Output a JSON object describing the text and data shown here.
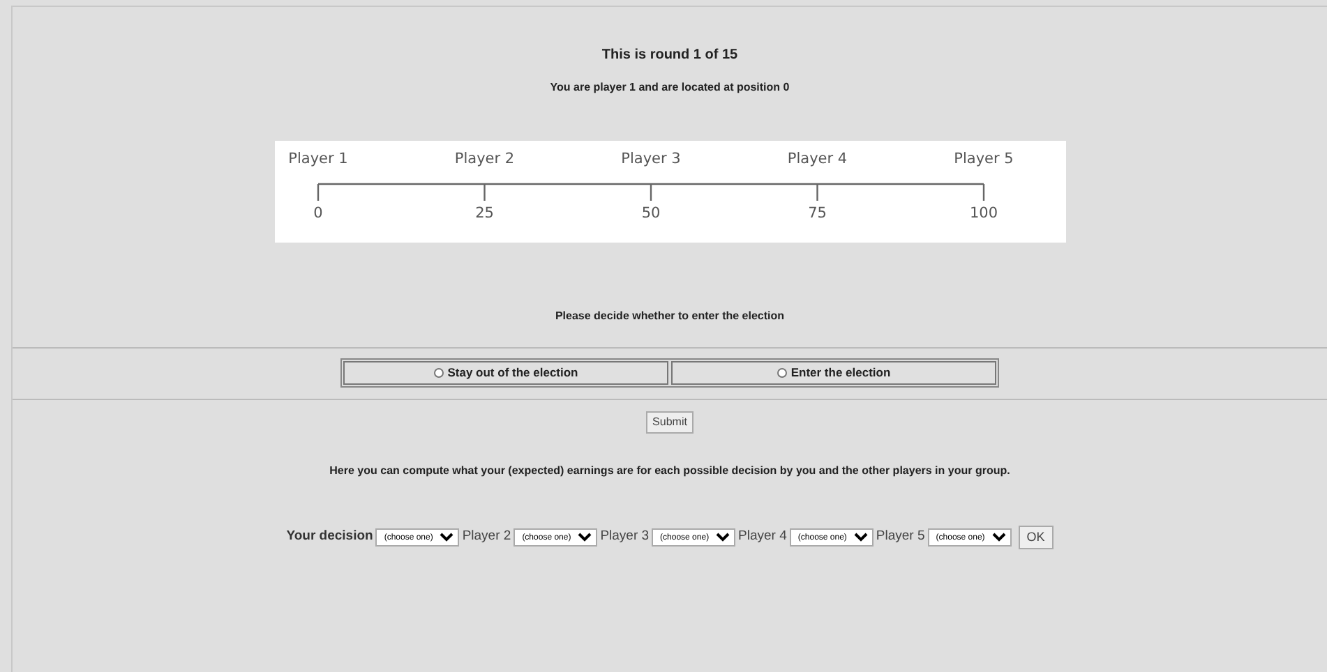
{
  "header": {
    "round": "This is round 1 of 15",
    "player_info": "You are player 1 and are located at position 0"
  },
  "number_line": {
    "players": [
      "Player 1",
      "Player 2",
      "Player 3",
      "Player 4",
      "Player 5"
    ],
    "positions": [
      "0",
      "25",
      "50",
      "75",
      "100"
    ]
  },
  "prompt": "Please decide whether to enter the election",
  "options": [
    {
      "label": "Stay out of the election",
      "selected": false
    },
    {
      "label": "Enter the election",
      "selected": false
    }
  ],
  "submit": "Submit",
  "calculator": {
    "intro": "Here you can compute what your (expected) earnings are for each possible decision by you and the other players in your group.",
    "fields": [
      {
        "label": "Your decision",
        "placeholder": "(choose one)"
      },
      {
        "label": "Player 2",
        "placeholder": "(choose one)"
      },
      {
        "label": "Player 3",
        "placeholder": "(choose one)"
      },
      {
        "label": "Player 4",
        "placeholder": "(choose one)"
      },
      {
        "label": "Player 5",
        "placeholder": "(choose one)"
      }
    ],
    "ok": "OK"
  }
}
